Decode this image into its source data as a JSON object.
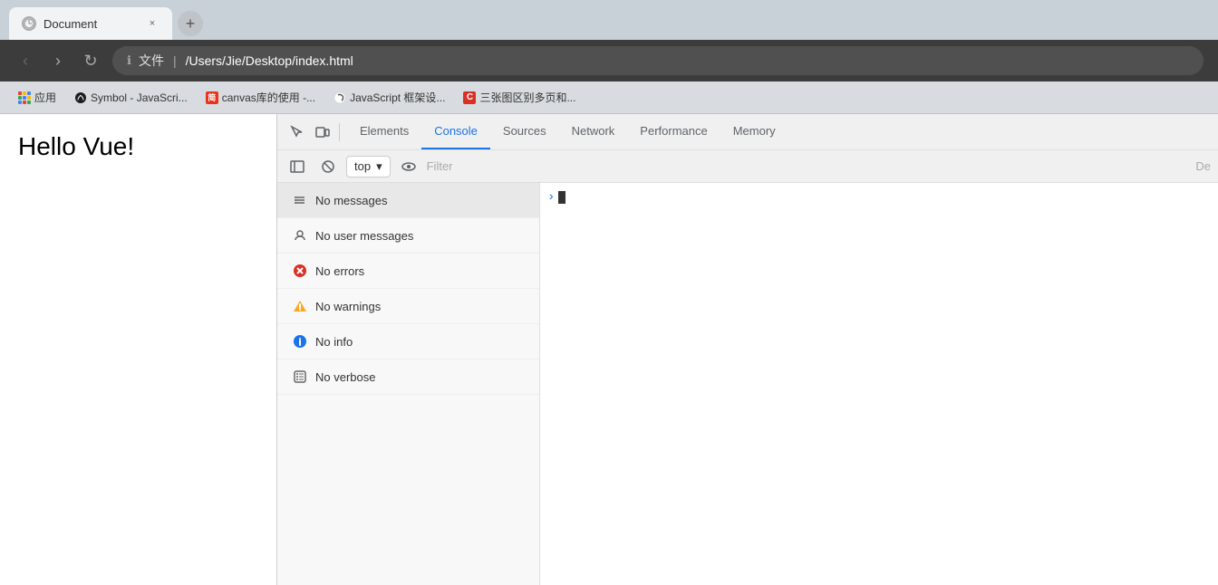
{
  "browser": {
    "tab": {
      "title": "Document",
      "close_label": "×"
    },
    "new_tab_label": "+",
    "nav": {
      "back": "‹",
      "forward": "›",
      "reload": "↻"
    },
    "address": {
      "protocol": "文件",
      "separator": "|",
      "path": "/Users/Jie/Desktop/index.html"
    },
    "bookmarks": [
      {
        "icon_type": "grid",
        "label": "应用"
      },
      {
        "icon_type": "penguin",
        "label": "Symbol - JavaScri..."
      },
      {
        "icon_type": "book",
        "label": "canvas库的使用 -..."
      },
      {
        "icon_type": "person",
        "label": "JavaScript 框架设..."
      },
      {
        "icon_type": "c-logo",
        "label": "三张图区别多页和..."
      }
    ]
  },
  "page": {
    "main_text": "Hello Vue!"
  },
  "devtools": {
    "toolbar_icons": [
      "cursor-icon",
      "mobile-icon"
    ],
    "tabs": [
      {
        "label": "Elements",
        "active": false
      },
      {
        "label": "Console",
        "active": true
      },
      {
        "label": "Sources",
        "active": false
      },
      {
        "label": "Network",
        "active": false
      },
      {
        "label": "Performance",
        "active": false
      },
      {
        "label": "Memory",
        "active": false
      }
    ],
    "console": {
      "dropdown_label": "top",
      "dropdown_arrow": "▾",
      "filter_placeholder": "Filter",
      "de_label": "De",
      "sidebar_items": [
        {
          "icon_type": "list",
          "label": "No messages",
          "active": true
        },
        {
          "icon_type": "user",
          "label": "No user messages",
          "active": false
        },
        {
          "icon_type": "error",
          "label": "No errors",
          "active": false
        },
        {
          "icon_type": "warning",
          "label": "No warnings",
          "active": false
        },
        {
          "icon_type": "info",
          "label": "No info",
          "active": false
        },
        {
          "icon_type": "verbose",
          "label": "No verbose",
          "active": false
        }
      ],
      "prompt_symbol": ">",
      "cursor": ""
    }
  }
}
